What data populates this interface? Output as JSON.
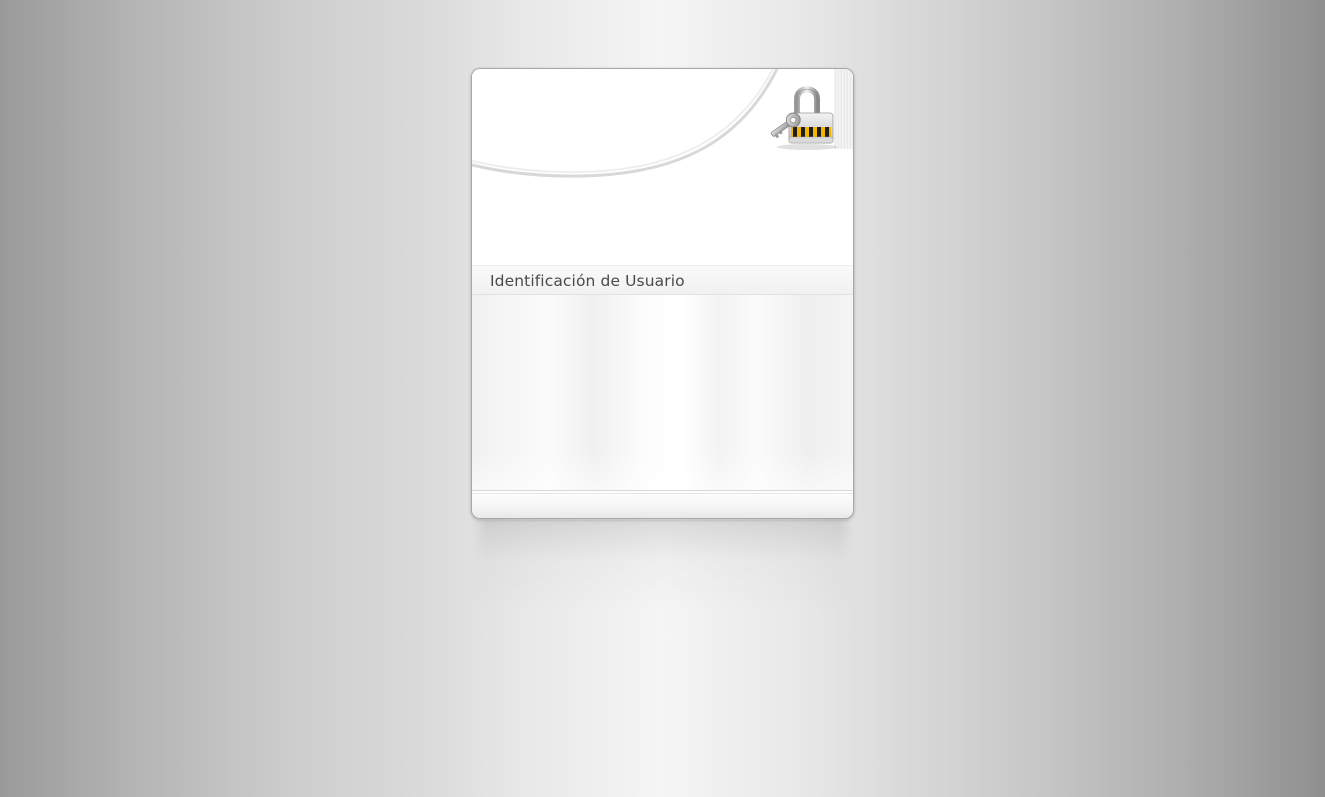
{
  "page": {
    "background_color_center": "#f5f5f5",
    "background_color_edges": "#9a9a9a"
  },
  "login_panel": {
    "title": "Identificación de Usuario",
    "header_icon": "lock-and-key-icon",
    "accent_colors": {
      "lock_stripes_yellow": "#f2b600",
      "lock_stripes_black": "#1e1e1e"
    }
  }
}
